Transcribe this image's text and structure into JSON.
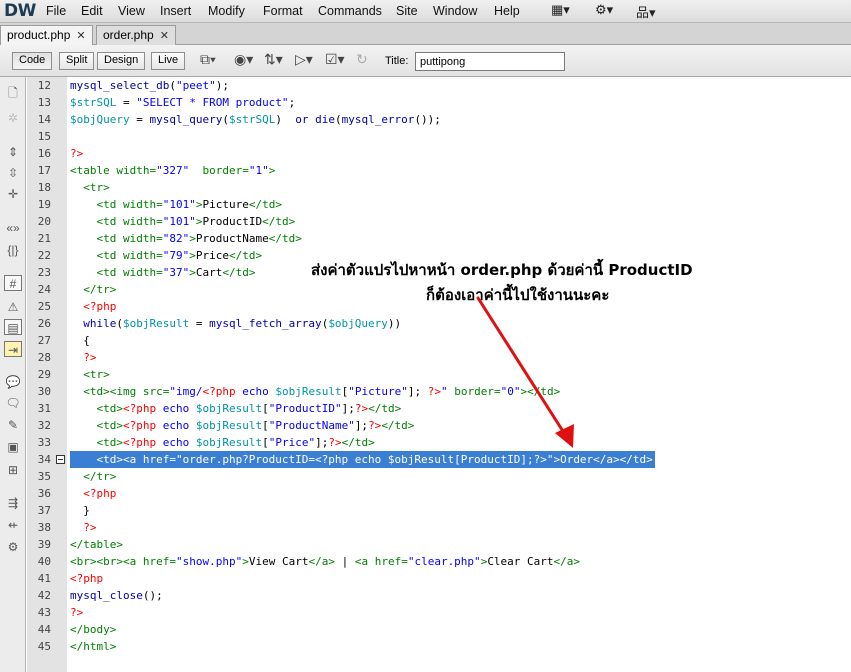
{
  "app": {
    "logo": "DW"
  },
  "menu": [
    "File",
    "Edit",
    "View",
    "Insert",
    "Modify",
    "Format",
    "Commands",
    "Site",
    "Window",
    "Help"
  ],
  "menu_icons": [
    "layout-icon",
    "gear-icon",
    "sitemap-icon"
  ],
  "tabs": [
    {
      "label": "product.php",
      "active": true
    },
    {
      "label": "order.php",
      "active": false
    }
  ],
  "toolbar": {
    "code_label": "Code",
    "split_label": "Split",
    "design_label": "Design",
    "live_label": "Live",
    "title_label": "Title:",
    "title_value": "puttipong"
  },
  "line_numbers": [
    "12",
    "13",
    "14",
    "15",
    "16",
    "17",
    "18",
    "19",
    "20",
    "21",
    "22",
    "23",
    "24",
    "25",
    "26",
    "27",
    "28",
    "29",
    "30",
    "31",
    "32",
    "33",
    "34",
    "35",
    "36",
    "37",
    "38",
    "39",
    "40",
    "41",
    "42",
    "43",
    "44",
    "45"
  ],
  "code_lines": [
    [
      [
        "fn",
        "mysql_select_db"
      ],
      [
        "dk",
        "("
      ],
      [
        "str",
        "\"peet\""
      ],
      [
        "dk",
        ");"
      ]
    ],
    [
      [
        "var",
        "$strSQL"
      ],
      [
        "dk",
        " = "
      ],
      [
        "str",
        "\"SELECT * FROM product\""
      ],
      [
        "dk",
        ";"
      ]
    ],
    [
      [
        "var",
        "$objQuery"
      ],
      [
        "dk",
        " = "
      ],
      [
        "fn",
        "mysql_query"
      ],
      [
        "dk",
        "("
      ],
      [
        "var",
        "$strSQL"
      ],
      [
        "dk",
        ")  "
      ],
      [
        "fn",
        "or die"
      ],
      [
        "dk",
        "("
      ],
      [
        "fn",
        "mysql_error"
      ],
      [
        "dk",
        "());"
      ]
    ],
    [],
    [
      [
        "php",
        "?>"
      ]
    ],
    [
      [
        "tag",
        "<table "
      ],
      [
        "tag",
        "width="
      ],
      [
        "aval",
        "\"327\""
      ],
      [
        "tag",
        "  border="
      ],
      [
        "aval",
        "\"1\""
      ],
      [
        "tag",
        ">"
      ]
    ],
    [
      [
        "tag",
        "  <tr>"
      ]
    ],
    [
      [
        "tag",
        "    <td "
      ],
      [
        "tag",
        "width="
      ],
      [
        "aval",
        "\"101\""
      ],
      [
        "tag",
        ">"
      ],
      [
        "txt",
        "Picture"
      ],
      [
        "tag",
        "</td>"
      ]
    ],
    [
      [
        "tag",
        "    <td "
      ],
      [
        "tag",
        "width="
      ],
      [
        "aval",
        "\"101\""
      ],
      [
        "tag",
        ">"
      ],
      [
        "txt",
        "ProductID"
      ],
      [
        "tag",
        "</td>"
      ]
    ],
    [
      [
        "tag",
        "    <td "
      ],
      [
        "tag",
        "width="
      ],
      [
        "aval",
        "\"82\""
      ],
      [
        "tag",
        ">"
      ],
      [
        "txt",
        "ProductName"
      ],
      [
        "tag",
        "</td>"
      ]
    ],
    [
      [
        "tag",
        "    <td "
      ],
      [
        "tag",
        "width="
      ],
      [
        "aval",
        "\"79\""
      ],
      [
        "tag",
        ">"
      ],
      [
        "txt",
        "Price"
      ],
      [
        "tag",
        "</td>"
      ]
    ],
    [
      [
        "tag",
        "    <td "
      ],
      [
        "tag",
        "width="
      ],
      [
        "aval",
        "\"37\""
      ],
      [
        "tag",
        ">"
      ],
      [
        "txt",
        "Cart"
      ],
      [
        "tag",
        "</td>"
      ]
    ],
    [
      [
        "tag",
        "  </tr>"
      ]
    ],
    [
      [
        "php",
        "  <?php"
      ]
    ],
    [
      [
        "fn",
        "  while"
      ],
      [
        "dk",
        "("
      ],
      [
        "var",
        "$objResult"
      ],
      [
        "dk",
        " = "
      ],
      [
        "fn",
        "mysql_fetch_array"
      ],
      [
        "dk",
        "("
      ],
      [
        "var",
        "$objQuery"
      ],
      [
        "dk",
        "))"
      ]
    ],
    [
      [
        "dk",
        "  {"
      ]
    ],
    [
      [
        "php",
        "  ?>"
      ]
    ],
    [
      [
        "tag",
        "  <tr>"
      ]
    ],
    [
      [
        "tag",
        "  <td>"
      ],
      [
        "tag",
        "<img "
      ],
      [
        "tag",
        "src="
      ],
      [
        "aval",
        "\"img/"
      ],
      [
        "php",
        "<?php "
      ],
      [
        "kw",
        "echo "
      ],
      [
        "var",
        "$objResult"
      ],
      [
        "dk",
        "["
      ],
      [
        "str",
        "\"Picture\""
      ],
      [
        "dk",
        "]; "
      ],
      [
        "php",
        "?>"
      ],
      [
        "aval",
        "\" "
      ],
      [
        "tag",
        "border="
      ],
      [
        "aval",
        "\"0\""
      ],
      [
        "tag",
        ">"
      ],
      [
        "tag",
        "</td>"
      ]
    ],
    [
      [
        "tag",
        "    <td>"
      ],
      [
        "php",
        "<?php "
      ],
      [
        "kw",
        "echo "
      ],
      [
        "var",
        "$objResult"
      ],
      [
        "dk",
        "["
      ],
      [
        "str",
        "\"ProductID\""
      ],
      [
        "dk",
        "];"
      ],
      [
        "php",
        "?>"
      ],
      [
        "tag",
        "</td>"
      ]
    ],
    [
      [
        "tag",
        "    <td>"
      ],
      [
        "php",
        "<?php "
      ],
      [
        "kw",
        "echo "
      ],
      [
        "var",
        "$objResult"
      ],
      [
        "dk",
        "["
      ],
      [
        "str",
        "\"ProductName\""
      ],
      [
        "dk",
        "];"
      ],
      [
        "php",
        "?>"
      ],
      [
        "tag",
        "</td>"
      ]
    ],
    [
      [
        "tag",
        "    <td>"
      ],
      [
        "php",
        "<?php "
      ],
      [
        "kw",
        "echo "
      ],
      [
        "var",
        "$objResult"
      ],
      [
        "dk",
        "["
      ],
      [
        "str",
        "\"Price\""
      ],
      [
        "dk",
        "];"
      ],
      [
        "php",
        "?>"
      ],
      [
        "tag",
        "</td>"
      ]
    ],
    [
      [
        "txt",
        "    <td><a href=\"order.php?ProductID=<?php echo $objResult[ProductID];?>\">Order</a></td>"
      ]
    ],
    [
      [
        "tag",
        "  </tr>"
      ]
    ],
    [
      [
        "php",
        "  <?php"
      ]
    ],
    [
      [
        "dk",
        "  }"
      ]
    ],
    [
      [
        "php",
        "  ?>"
      ]
    ],
    [
      [
        "tag",
        "</table>"
      ]
    ],
    [
      [
        "tag",
        "<br><br><a "
      ],
      [
        "tag",
        "href="
      ],
      [
        "aval",
        "\"show.php\""
      ],
      [
        "tag",
        ">"
      ],
      [
        "txt",
        "View Cart"
      ],
      [
        "tag",
        "</a>"
      ],
      [
        "txt",
        " | "
      ],
      [
        "tag",
        "<a "
      ],
      [
        "tag",
        "href="
      ],
      [
        "aval",
        "\"clear.php\""
      ],
      [
        "tag",
        ">"
      ],
      [
        "txt",
        "Clear Cart"
      ],
      [
        "tag",
        "</a>"
      ]
    ],
    [
      [
        "php",
        "<?php"
      ]
    ],
    [
      [
        "fn",
        "mysql_close"
      ],
      [
        "dk",
        "();"
      ]
    ],
    [
      [
        "php",
        "?>"
      ]
    ],
    [
      [
        "tag",
        "</body>"
      ]
    ],
    [
      [
        "tag",
        "</html>"
      ]
    ]
  ],
  "selected_line": "34",
  "annotation": {
    "line1": "ส่งค่าตัวแปรไปหาหน้า order.php ด้วยค่านี้ ProductID",
    "line2": "ก็ต้องเอาค่านี้ไปใช้งานนะคะ",
    "arrow_color": "#e01010"
  },
  "colors": {
    "selection": "#3b7fd4",
    "gutter": "#e3e3e3"
  }
}
